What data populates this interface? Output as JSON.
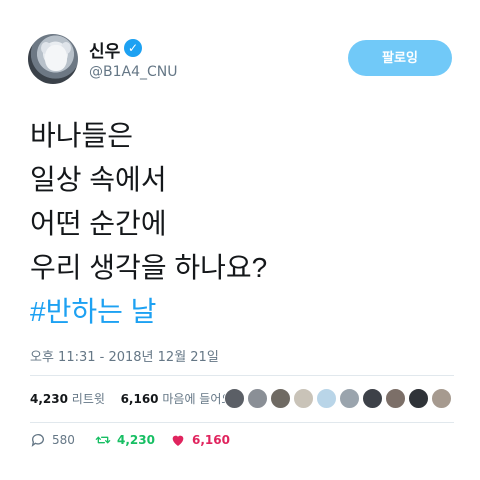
{
  "user": {
    "display_name": "신우",
    "handle": "@B1A4_CNU",
    "verified": true
  },
  "follow_button": {
    "label": "팔로잉"
  },
  "tweet": {
    "lines": [
      "바나들은",
      "일상 속에서",
      "어떤 순간에",
      "우리 생각을 하나요?"
    ],
    "hashtag": "#반하는 날"
  },
  "timestamp": "오후 11:31 - 2018년 12월 21일",
  "stats": {
    "retweet_count": "4,230",
    "retweet_label": "리트윗",
    "like_count": "6,160",
    "like_label": "마음에 들어요"
  },
  "likers": [
    {
      "color": "#5b5f66"
    },
    {
      "color": "#8a8f96"
    },
    {
      "color": "#6f6a63"
    },
    {
      "color": "#c9c3b8"
    },
    {
      "color": "#b9d5e8"
    },
    {
      "color": "#9aa4ad"
    },
    {
      "color": "#3d4148"
    },
    {
      "color": "#7c6f68"
    },
    {
      "color": "#2f3338"
    },
    {
      "color": "#a69a8f"
    }
  ],
  "actions": {
    "reply_count": "580",
    "retweet_count": "4,230",
    "like_count": "6,160"
  },
  "colors": {
    "accent": "#1da1f2",
    "retweet": "#17bf63",
    "like": "#e0245e",
    "follow_button": "#71c9f8"
  }
}
